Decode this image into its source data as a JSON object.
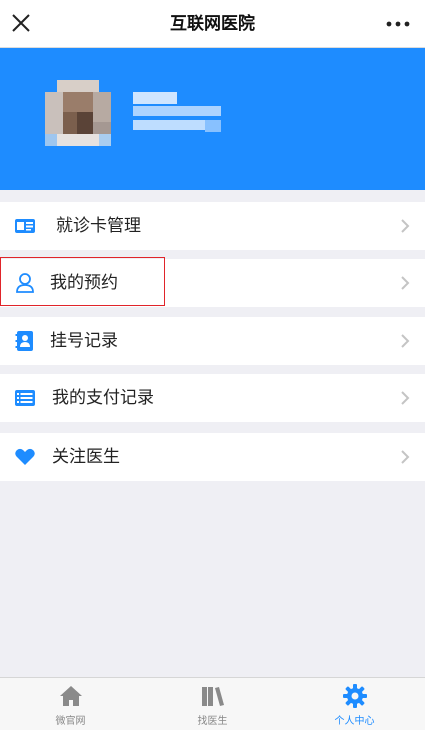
{
  "header": {
    "title": "互联网医院"
  },
  "menu": {
    "items": [
      {
        "label": "就诊卡管理",
        "icon": "id-card-icon"
      },
      {
        "label": "我的预约",
        "icon": "user-outline-icon"
      },
      {
        "label": "挂号记录",
        "icon": "contact-book-icon"
      },
      {
        "label": "我的支付记录",
        "icon": "list-card-icon"
      },
      {
        "label": "关注医生",
        "icon": "heart-icon"
      }
    ]
  },
  "tabbar": {
    "items": [
      {
        "label": "微官网",
        "icon": "home-icon",
        "active": false
      },
      {
        "label": "找医生",
        "icon": "books-icon",
        "active": false
      },
      {
        "label": "个人中心",
        "icon": "gear-icon",
        "active": true
      }
    ]
  },
  "colors": {
    "accent": "#1e8cff",
    "highlight_border": "#e0242a",
    "background": "#efeff4"
  }
}
